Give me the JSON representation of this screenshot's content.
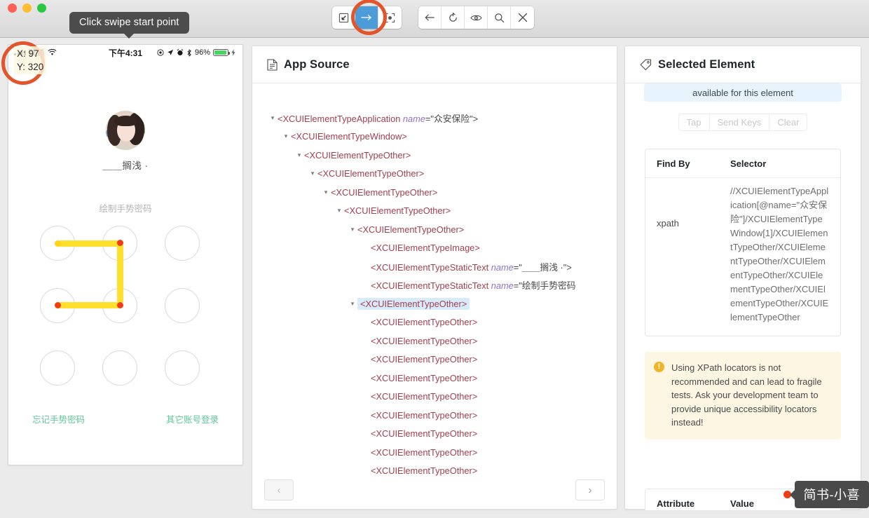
{
  "window": {
    "tooltip": "Click swipe start point",
    "traffic_lights": [
      "close",
      "minimize",
      "maximize"
    ]
  },
  "toolbar": {
    "left_group": [
      {
        "icon": "select-element-icon",
        "label": "Select Element",
        "active": false
      },
      {
        "icon": "swipe-arrow-icon",
        "label": "Swipe By Coordinates",
        "active": true
      },
      {
        "icon": "tap-by-coordinates-icon",
        "label": "Tap By Coordinates",
        "active": false
      }
    ],
    "right_group": [
      {
        "icon": "back-arrow-icon",
        "label": "Back"
      },
      {
        "icon": "refresh-icon",
        "label": "Refresh Source"
      },
      {
        "icon": "eye-icon",
        "label": "Start Recording"
      },
      {
        "icon": "search-icon",
        "label": "Search for element"
      },
      {
        "icon": "close-x-icon",
        "label": "Quit Session"
      }
    ]
  },
  "device": {
    "coords": {
      "x_label": "X: 97",
      "y_label": "Y: 320"
    },
    "status_bar": {
      "carrier": "联通",
      "wifi_icon": "wifi-icon",
      "time": "下午4:31",
      "icons": [
        "target-icon",
        "location-arrow-icon",
        "alarm-icon",
        "bluetooth-icon"
      ],
      "battery_percent": "96%",
      "charging": true
    },
    "user_name": "＿＿搁浅 ·",
    "gesture_hint": "绘制手势密码",
    "pattern": {
      "grid": 3,
      "path": [
        1,
        2,
        5,
        4
      ],
      "line_color": "#ffe02e",
      "end_dot_color": "#f53b12"
    },
    "links": [
      "忘记手势密码",
      "其它账号登录"
    ]
  },
  "source_panel": {
    "title": "App Source",
    "icon": "document-icon",
    "pager_prev": "‹",
    "pager_next": "›",
    "tree": [
      {
        "depth": 0,
        "caret": "▾",
        "tag": "<XCUIElementTypeApplication ",
        "attr": "name",
        "eq": "=\"",
        "val": "众安保险",
        "close": "\">",
        "selected": false
      },
      {
        "depth": 1,
        "caret": "▾",
        "tag": "<XCUIElementTypeWindow>",
        "selected": false
      },
      {
        "depth": 2,
        "caret": "▾",
        "tag": "<XCUIElementTypeOther>",
        "selected": false
      },
      {
        "depth": 3,
        "caret": "▾",
        "tag": "<XCUIElementTypeOther>",
        "selected": false
      },
      {
        "depth": 4,
        "caret": "▾",
        "tag": "<XCUIElementTypeOther>",
        "selected": false
      },
      {
        "depth": 5,
        "caret": "▾",
        "tag": "<XCUIElementTypeOther>",
        "selected": false
      },
      {
        "depth": 6,
        "caret": "▾",
        "tag": "<XCUIElementTypeOther>",
        "selected": false
      },
      {
        "depth": 7,
        "caret": "",
        "tag": "<XCUIElementTypeImage>",
        "selected": false
      },
      {
        "depth": 7,
        "caret": "",
        "tag": "<XCUIElementTypeStaticText ",
        "attr": "name",
        "eq": "=\"",
        "val": "＿＿搁浅 ·",
        "close": "\">",
        "selected": false
      },
      {
        "depth": 7,
        "caret": "",
        "tag": "<XCUIElementTypeStaticText ",
        "attr": "name",
        "eq": "=\"",
        "val": "绘制手势密码",
        "close": "",
        "selected": false
      },
      {
        "depth": 6,
        "caret": "▾",
        "tag": "<XCUIElementTypeOther>",
        "selected": true
      },
      {
        "depth": 7,
        "caret": "",
        "tag": "<XCUIElementTypeOther>",
        "selected": false
      },
      {
        "depth": 7,
        "caret": "",
        "tag": "<XCUIElementTypeOther>",
        "selected": false
      },
      {
        "depth": 7,
        "caret": "",
        "tag": "<XCUIElementTypeOther>",
        "selected": false
      },
      {
        "depth": 7,
        "caret": "",
        "tag": "<XCUIElementTypeOther>",
        "selected": false
      },
      {
        "depth": 7,
        "caret": "",
        "tag": "<XCUIElementTypeOther>",
        "selected": false
      },
      {
        "depth": 7,
        "caret": "",
        "tag": "<XCUIElementTypeOther>",
        "selected": false
      },
      {
        "depth": 7,
        "caret": "",
        "tag": "<XCUIElementTypeOther>",
        "selected": false
      },
      {
        "depth": 7,
        "caret": "",
        "tag": "<XCUIElementTypeOther>",
        "selected": false
      },
      {
        "depth": 7,
        "caret": "",
        "tag": "<XCUIElementTypeOther>",
        "selected": false
      }
    ]
  },
  "selected_panel": {
    "title": "Selected Element",
    "icon": "tag-icon",
    "info_text": "available for this element",
    "actions": [
      "Tap",
      "Send Keys",
      "Clear"
    ],
    "find_table": {
      "headers": [
        "Find By",
        "Selector"
      ],
      "rows": [
        {
          "find_by": "xpath",
          "selector": "//XCUIElementTypeApplication[@name=\"众安保险\"]/XCUIElementTypeWindow[1]/XCUIElementTypeOther/XCUIElementTypeOther/XCUIElementTypeOther/XCUIElementTypeOther/XCUIElementTypeOther/XCUIElementTypeOther"
        }
      ]
    },
    "warning": {
      "icon": "exclamation-icon",
      "text": "Using XPath locators is not recommended and can lead to fragile tests. Ask your development team to provide unique accessibility locators instead!"
    },
    "attribute_table": {
      "headers": [
        "Attribute",
        "Value"
      ]
    }
  },
  "watermark": {
    "text": "简书-小喜",
    "dot_color": "#f03c13"
  }
}
